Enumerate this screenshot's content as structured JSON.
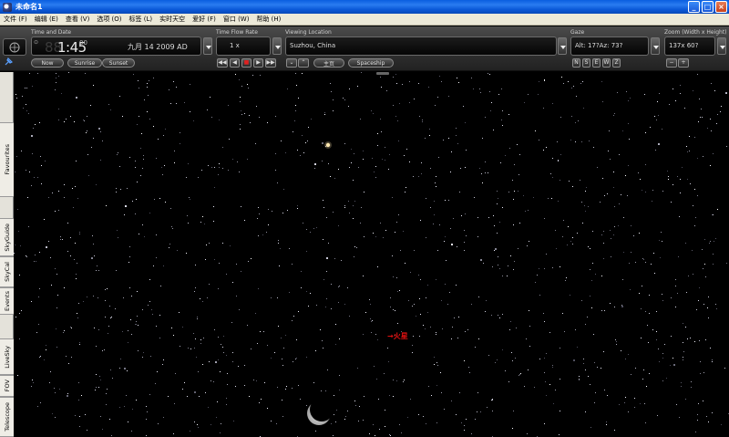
{
  "window": {
    "title": "未命名1",
    "controls": {
      "minimize": "_",
      "maximize": "□",
      "close": "×"
    }
  },
  "menu": [
    "文件 (F)",
    "编辑 (E)",
    "查看 (V)",
    "选项 (O)",
    "标签 (L)",
    "实时天空",
    "爱好 (F)",
    "窗口 (W)",
    "帮助 (H)"
  ],
  "toolbar": {
    "time_date_label": "Time and Date",
    "time_ghost": "88",
    "time": "1:45",
    "seconds": "00",
    "date": "九月  14    2009 AD",
    "now_button": "Now",
    "sunrise_button": "Sunrise",
    "sunset_button": "Sunset",
    "time_flow_label": "Time Flow Rate",
    "time_flow_value": "1 x",
    "playback": [
      "◀◀",
      "◀",
      "■",
      "▶",
      "▶▶"
    ],
    "viewing_location_label": "Viewing Location",
    "location": "Suzhou, China",
    "nav_buttons": [
      "⌄",
      "⌃"
    ],
    "home_button": "主页",
    "spaceship_button": "Spaceship",
    "gaze_label": "Gaze",
    "gaze_value": "Alt: 17?Az: 73?",
    "compass": [
      "N",
      "S",
      "E",
      "W",
      "Z"
    ],
    "zoom_label": "Zoom (Width x Height)",
    "zoom_value": "137x 60?",
    "zoom_out": "−",
    "zoom_in": "+"
  },
  "side_tabs": [
    "Favourites",
    "SkyGuide",
    "SkyCal",
    "Events",
    "LiveSky",
    "FOV",
    "Telescope"
  ],
  "sky": {
    "planet_label": "→火星",
    "label_color": "#e01010",
    "bright_star_color": "#ffe9b0"
  }
}
